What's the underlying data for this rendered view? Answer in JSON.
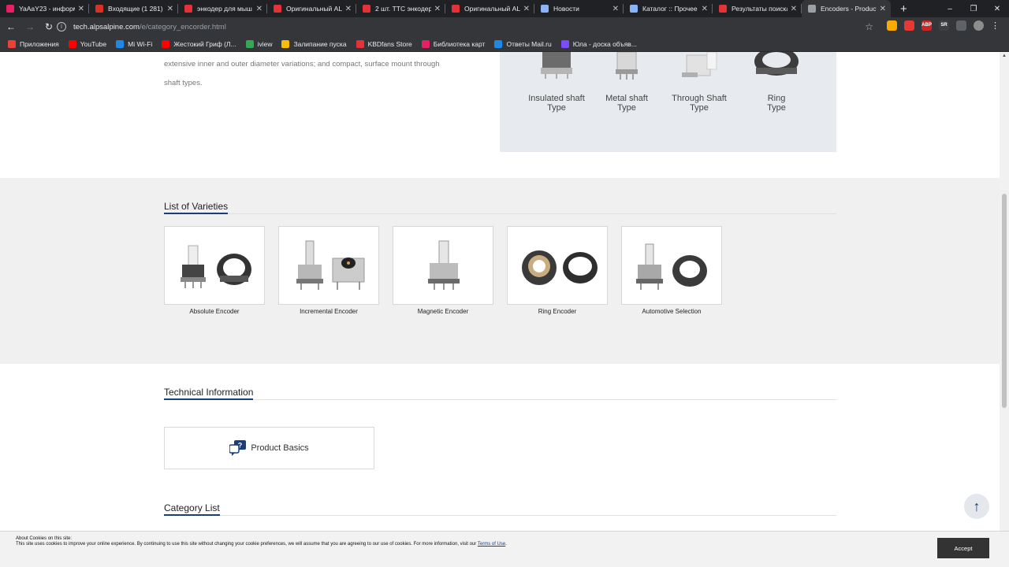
{
  "browser": {
    "tabs": [
      {
        "title": "YaAaY23 - информ",
        "favicon_color": "#e91e63",
        "active": false
      },
      {
        "title": "Входящие (1 281) -",
        "favicon_color": "#d93025",
        "active": false
      },
      {
        "title": "энкодер для мыш",
        "favicon_color": "#e53238",
        "active": false
      },
      {
        "title": "Оригинальный ALI",
        "favicon_color": "#e53238",
        "active": false
      },
      {
        "title": "2 шт. TTC энкодер",
        "favicon_color": "#e53238",
        "active": false
      },
      {
        "title": "Оригинальный ALI",
        "favicon_color": "#e53238",
        "active": false
      },
      {
        "title": "Новости",
        "favicon_color": "#8ab4f8",
        "active": false
      },
      {
        "title": "Каталог :: Прочее",
        "favicon_color": "#8ab4f8",
        "active": false
      },
      {
        "title": "Результаты поиска",
        "favicon_color": "#e53238",
        "active": false
      },
      {
        "title": "Encoders - Product",
        "favicon_color": "#9aa0a6",
        "active": true
      }
    ],
    "new_tab": "+",
    "url_host": "tech.alpsalpine.com",
    "url_path": "/e/category_encorder.html",
    "bookmarks": [
      {
        "label": "Приложения",
        "color": "#ea4335"
      },
      {
        "label": "YouTube",
        "color": "#ff0000"
      },
      {
        "label": "Mi Wi-Fi",
        "color": "#1e88e5"
      },
      {
        "label": "Жестокий Гриф (Л...",
        "color": "#ff0000"
      },
      {
        "label": "iview",
        "color": "#34a853"
      },
      {
        "label": "Залипание пуска",
        "color": "#fbbc05"
      },
      {
        "label": "KBDfans Store",
        "color": "#e53238"
      },
      {
        "label": "Библиотека карт",
        "color": "#e91e63"
      },
      {
        "label": "Ответы Mail.ru",
        "color": "#1e88e5"
      },
      {
        "label": "Юла - доска объяв...",
        "color": "#7c4dff"
      }
    ],
    "extensions": [
      {
        "label": "",
        "color": "#f9ab00"
      },
      {
        "label": "",
        "color": "#e53935"
      },
      {
        "label": "ABP",
        "color": "#c62828"
      },
      {
        "label": "SR",
        "color": "#3c4043"
      },
      {
        "label": "",
        "color": "#5f6368"
      }
    ]
  },
  "intro": {
    "text_line1": "extensive inner and outer diameter variations; and compact, surface mount through",
    "text_line2": "shaft types."
  },
  "types": [
    {
      "line1": "Insulated shaft",
      "line2": "Type"
    },
    {
      "line1": "Metal shaft",
      "line2": "Type"
    },
    {
      "line1": "Through Shaft",
      "line2": "Type"
    },
    {
      "line1": "Ring",
      "line2": "Type"
    }
  ],
  "varieties": {
    "heading": "List of Varieties",
    "items": [
      {
        "label": "Absolute Encoder"
      },
      {
        "label": "Incremental Encoder"
      },
      {
        "label": "Magnetic Encoder"
      },
      {
        "label": "Ring Encoder"
      },
      {
        "label": "Automotive Selection"
      }
    ]
  },
  "technical": {
    "heading": "Technical Information",
    "product_basics": "Product Basics"
  },
  "category": {
    "heading": "Category List"
  },
  "cookie": {
    "title": "About Cookies on this site:",
    "body": "This site uses cookies to improve your online experience. By continuing to use this site without changing your cookie preferences, we will assume that you are agreeing to our use of cookies. For more information, visit our",
    "link": "Terms of Use",
    "accept": "Accept"
  }
}
